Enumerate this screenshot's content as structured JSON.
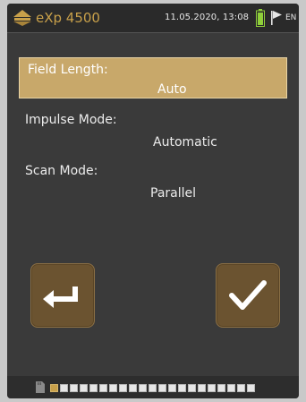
{
  "header": {
    "app_name": "eXp 4500",
    "datetime": "11.05.2020, 13:08",
    "language": "EN",
    "icons": [
      "logo-icon",
      "battery-icon",
      "flag-icon"
    ]
  },
  "settings": [
    {
      "label": "Field Length:",
      "value": "Auto",
      "selected": true
    },
    {
      "label": "Impulse Mode:",
      "value": "Automatic",
      "selected": false
    },
    {
      "label": "Scan Mode:",
      "value": "Parallel",
      "selected": false
    }
  ],
  "buttons": {
    "back_icon": "return-arrow-icon",
    "confirm_icon": "checkmark-icon"
  },
  "footer": {
    "storage_icon": "sd-card-icon",
    "page_count": 21,
    "active_page": 1
  },
  "colors": {
    "accent": "#c8a04a",
    "selected_bg": "#c8a86a",
    "button_bg": "#6b5330",
    "screen_bg": "#3a3a3a"
  }
}
